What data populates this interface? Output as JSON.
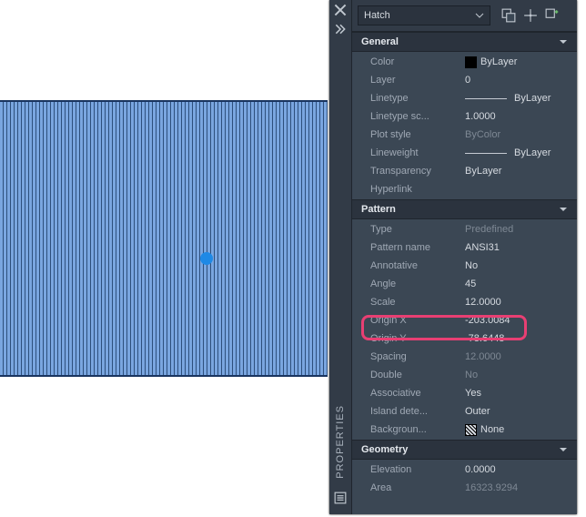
{
  "palette": {
    "title": "PROPERTIES",
    "selector": "Hatch"
  },
  "sections": {
    "general": {
      "title": "General",
      "color_label": "Color",
      "color_value": "ByLayer",
      "layer_label": "Layer",
      "layer_value": "0",
      "linetype_label": "Linetype",
      "linetype_value": "ByLayer",
      "ltscale_label": "Linetype sc...",
      "ltscale_value": "1.0000",
      "plotstyle_label": "Plot style",
      "plotstyle_value": "ByColor",
      "lineweight_label": "Lineweight",
      "lineweight_value": "ByLayer",
      "transparency_label": "Transparency",
      "transparency_value": "ByLayer",
      "hyperlink_label": "Hyperlink",
      "hyperlink_value": ""
    },
    "pattern": {
      "title": "Pattern",
      "type_label": "Type",
      "type_value": "Predefined",
      "name_label": "Pattern name",
      "name_value": "ANSI31",
      "annotative_label": "Annotative",
      "annotative_value": "No",
      "angle_label": "Angle",
      "angle_value": "45",
      "scale_label": "Scale",
      "scale_value": "12.0000",
      "ox_label": "Origin X",
      "ox_value": "-203.0084",
      "oy_label": "Origin Y",
      "oy_value": "-78.6448",
      "spacing_label": "Spacing",
      "spacing_value": "12.0000",
      "double_label": "Double",
      "double_value": "No",
      "assoc_label": "Associative",
      "assoc_value": "Yes",
      "island_label": "Island dete...",
      "island_value": "Outer",
      "bg_label": "Backgroun...",
      "bg_value": "None"
    },
    "geometry": {
      "title": "Geometry",
      "elev_label": "Elevation",
      "elev_value": "0.0000",
      "area_label": "Area",
      "area_value": "16323.9294"
    }
  }
}
